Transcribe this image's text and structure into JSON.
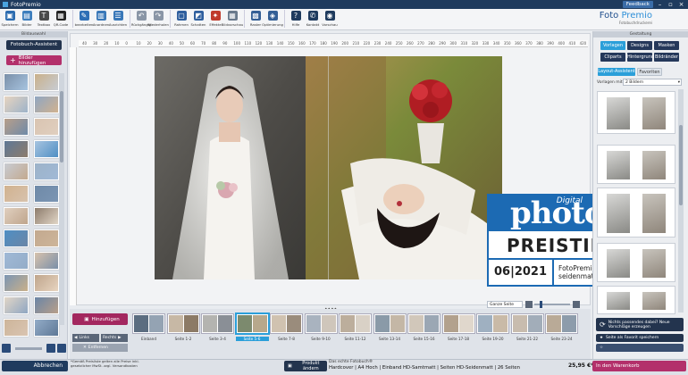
{
  "window": {
    "title": "FotoPremio",
    "feedback_label": "Feedback"
  },
  "toolbar": {
    "items": [
      {
        "label": "Speichern",
        "color": "#2b6cb0",
        "icon": "save-icon"
      },
      {
        "label": "Bilder",
        "color": "#3d7ebd",
        "icon": "image-icon"
      },
      {
        "label": "Textbox",
        "color": "#4a4a4a",
        "icon": "text-icon"
      },
      {
        "label": "QR-Code",
        "color": "#222222",
        "icon": "qr-icon"
      },
      {
        "label": "bearbeiten",
        "color": "#2f6fb6",
        "icon": "edit-icon"
      },
      {
        "label": "Anordnen",
        "color": "#3a78b8",
        "icon": "arrange-icon"
      },
      {
        "label": "Ausrichten",
        "color": "#3a78b8",
        "icon": "align-icon"
      },
      {
        "label": "Rückgängig",
        "color": "#8a96a6",
        "icon": "undo-icon"
      },
      {
        "label": "Wiederholen",
        "color": "#8a96a6",
        "icon": "redo-icon"
      },
      {
        "label": "Rahmen",
        "color": "#2f5f9e",
        "icon": "frame-icon"
      },
      {
        "label": "Schatten",
        "color": "#2f5f9e",
        "icon": "shadow-icon"
      },
      {
        "label": "Effekte",
        "color": "#c0392b",
        "icon": "effects-icon"
      },
      {
        "label": "Bildvorschau",
        "color": "#6a7a8c",
        "icon": "preview-icon"
      },
      {
        "label": "Raster",
        "color": "#345f95",
        "icon": "grid-icon"
      },
      {
        "label": "Optimierung",
        "color": "#345f95",
        "icon": "optimize-icon"
      },
      {
        "label": "Hilfe",
        "color": "#1f3b5e",
        "icon": "help-icon"
      },
      {
        "label": "Kontakt",
        "color": "#1f3b5e",
        "icon": "phone-icon"
      },
      {
        "label": "Vorschau",
        "color": "#1f3b5e",
        "icon": "eye-icon"
      }
    ]
  },
  "logo": {
    "foto": "Foto ",
    "premio": "Premio",
    "sub": "Fotobuchdruckerei"
  },
  "left": {
    "header": "Bildauswahl",
    "assistant_label": "Fotobuch-Assistent",
    "add_images_label": "Bilder hinzufügen"
  },
  "ruler": {
    "ticks": [
      "40",
      "30",
      "20",
      "10",
      "0",
      "10",
      "20",
      "30",
      "40",
      "50",
      "60",
      "70",
      "80",
      "90",
      "100",
      "110",
      "120",
      "130",
      "140",
      "150",
      "160",
      "170",
      "180",
      "190",
      "200",
      "210",
      "220",
      "230",
      "240",
      "250",
      "260",
      "270",
      "280",
      "290",
      "300",
      "310",
      "320",
      "330",
      "340",
      "350",
      "360",
      "370",
      "380",
      "390",
      "400",
      "410",
      "420"
    ]
  },
  "badge": {
    "digital": "Digital",
    "photo": "photo",
    "preistipp": "PREISTIPP",
    "date": "06|2021",
    "product": "FotoPremio HD seidenmatt"
  },
  "right": {
    "header": "Gestaltung",
    "tabs": [
      "Vorlagen",
      "Designs",
      "Masken",
      "Cliparts",
      "Hintergrund",
      "Bildränder"
    ],
    "subtabs": [
      "Layout-Assistent",
      "Favoriten"
    ],
    "filter_label": "Vorlagen mit:",
    "filter_value": "2 Bildern",
    "nothing_suitable": "Nichts passendes dabei? Neue Vorschläge erzeugen",
    "save_favorite": "Seite als Favorit speichern",
    "add_to_cart": "In den Warenkorb"
  },
  "filmstrip": {
    "add_label": "Hinzufügen",
    "links_label": "Links",
    "rechts_label": "Rechts",
    "remove_label": "Entfernen",
    "view_select": "Ganze Seite",
    "pages": [
      "Einband",
      "Seite 1-2",
      "Seite 3-4",
      "Seite 5-6",
      "Seite 7-8",
      "Seite 9-10",
      "Seite 11-12",
      "Seite 13-14",
      "Seite 15-16",
      "Seite 17-18",
      "Seite 19-20",
      "Seite 21-22",
      "Seite 23-24"
    ]
  },
  "status": {
    "cancel_label": "Abbrechen",
    "note": "*Gemäß Preisliste gelten alle Preise inkl. gesetzlicher MwSt. zzgl. Versandkosten",
    "change_product": "Produkt ändern",
    "product_line1": "Das echte Fotobuch®",
    "product_line2": "Hardcover | A4 Hoch | Einband HD-Samtmatt | Seiten HD-Seidenmatt | 26 Seiten",
    "price": "25,95 €*"
  },
  "colors": {
    "accent": "#2b9fd9",
    "navy": "#23344e",
    "pink": "#b3306b",
    "badge_blue": "#1c6ab3"
  }
}
